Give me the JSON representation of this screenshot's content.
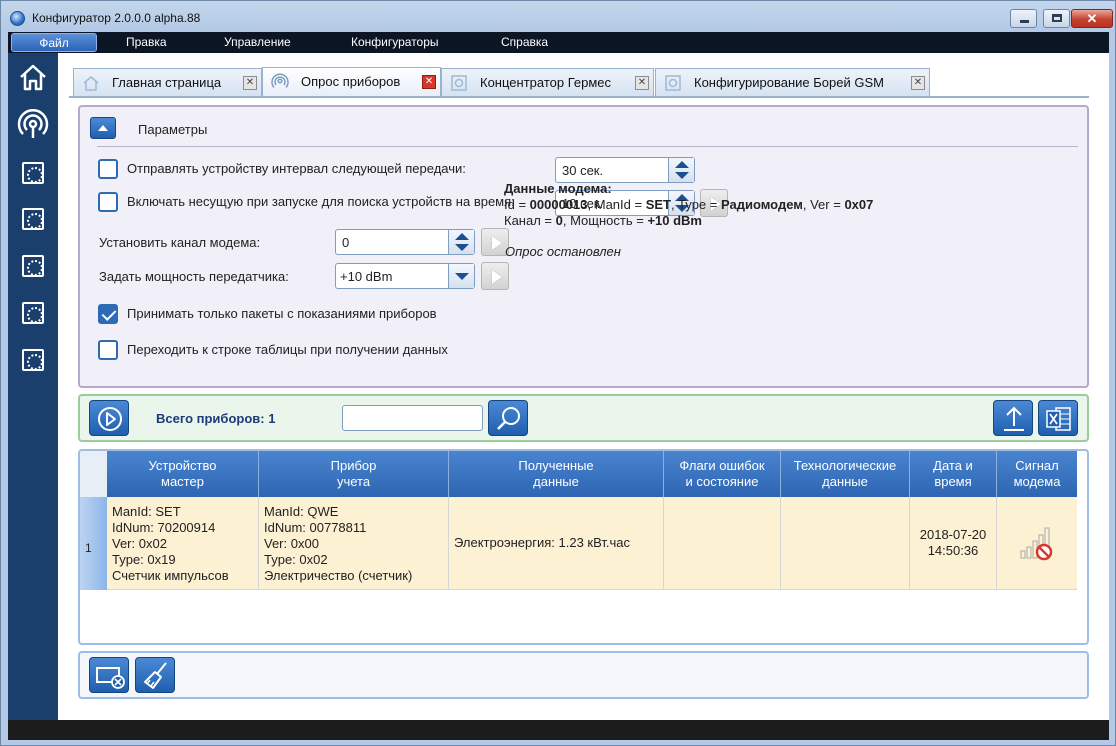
{
  "window": {
    "title": "Конфигуратор 2.0.0.0 alpha.88"
  },
  "menu": [
    "Файл",
    "Правка",
    "Управление",
    "Конфигураторы",
    "Справка"
  ],
  "tabs": [
    {
      "label": "Главная страница",
      "icon": "home-icon"
    },
    {
      "label": "Опрос приборов",
      "icon": "radio-signal-icon"
    },
    {
      "label": "Концентратор Гермес",
      "icon": "gear-icon"
    },
    {
      "label": "Конфигурирование Борей GSM",
      "icon": "gear-icon"
    }
  ],
  "params": {
    "title": "Параметры",
    "send_interval": {
      "label": "Отправлять устройству интервал следующей передачи:",
      "checked": false,
      "value": "30 сек."
    },
    "carrier": {
      "label": "Включать несущую при запуске для поиска устройств на время:",
      "checked": false,
      "value": "10 сек."
    },
    "channel": {
      "label": "Установить канал модема:",
      "value": "0"
    },
    "power": {
      "label": "Задать мощность передатчика:",
      "value": "+10 dBm"
    },
    "only_readings": {
      "label": "Принимать только пакеты с показаниями приборов",
      "checked": true
    },
    "goto_row": {
      "label": "Переходить к строке таблицы при получении данных",
      "checked": false
    },
    "modem": {
      "heading": "Данные модема:",
      "id_label": "Id = ",
      "id": "00000013",
      "manid_label": ", ManId = ",
      "manid": "SET",
      "type_label": ", Type = ",
      "type": "Радиомодем",
      "ver_label": ", Ver = ",
      "ver": "0x07",
      "channel_label": "Канал = ",
      "channel": "0",
      "power_label": ", Мощность = ",
      "power": "+10 dBm"
    },
    "status": "Опрос остановлен"
  },
  "toolbar": {
    "count_label": "Всего приборов: 1",
    "search_value": ""
  },
  "table": {
    "headers": [
      "Устройство\nмастер",
      "Прибор\nучета",
      "Полученные\nданные",
      "Флаги ошибок\nи состояние",
      "Технологические\nданные",
      "Дата и\nвремя",
      "Сигнал\nмодема"
    ],
    "rows": [
      {
        "num": "1",
        "master": [
          "ManId: SET",
          "IdNum: 70200914",
          "Ver: 0x02",
          "Type: 0x19",
          "Счетчик импульсов"
        ],
        "meter": [
          "ManId: QWE",
          "IdNum: 00778811",
          "Ver: 0x00",
          "Type: 0x02",
          "Электричество (счетчик)"
        ],
        "data": "Электроэнергия: 1.23 кВт.час",
        "flags": "",
        "tech": "",
        "date": "2018-07-20",
        "time": "14:50:36",
        "signal": "no-signal-icon"
      }
    ]
  }
}
